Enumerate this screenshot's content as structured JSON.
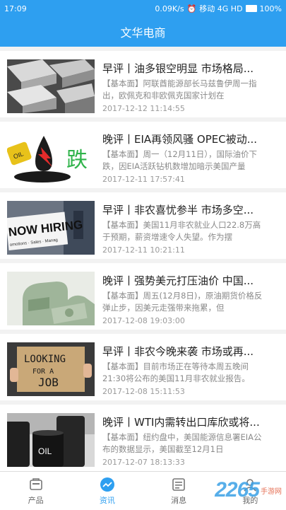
{
  "status_bar": {
    "time": "17:09",
    "network_speed": "0.09K/s",
    "carrier": "移动 4G HD",
    "battery": "100%"
  },
  "header": {
    "title": "文华电商"
  },
  "articles": [
    {
      "title": "早评丨油多银空明显 市场格局...",
      "desc": "【基本面】阿联酋能源部长马兹鲁伊周一指出，欧佩克和非欧佩克国家计划在",
      "time": "2017-12-12 11:14:55"
    },
    {
      "title": "晚评丨EIA再领风骚 OPEC被动...",
      "desc": "【基本面】周一（12月11日），国际油价下跌，因EIA活跃钻机数增加暗示美国产量",
      "time": "2017-12-11 17:57:41"
    },
    {
      "title": "早评丨非农喜忧参半 市场多空...",
      "desc": "【基本面】美国11月非农就业人口22.8万高于预期，薪资增速令人失望。作为摆",
      "time": "2017-12-11 10:21:11"
    },
    {
      "title": "晚评丨强势美元打压油价 中国...",
      "desc": "【基本面】周五(12月8日)，原油期货价格反弹止步，因美元走强带来拖累，但",
      "time": "2017-12-08 19:03:00"
    },
    {
      "title": "早评丨非农今晚来袭 市场或再...",
      "desc": "【基本面】目前市场正在等待本周五晚间21:30将公布的美国11月非农就业报告。",
      "time": "2017-12-08 15:11:53"
    },
    {
      "title": "晚评丨WTI内需转出口库欣或将...",
      "desc": "【基本面】纽约盘中，美国能源信息署EIA公布的数据显示，美国截至12月1日",
      "time": "2017-12-07 18:13:33"
    }
  ],
  "thumbnails": {
    "oil_label": "OIL",
    "die_label": "跌",
    "hiring_label": "NOW HIRING",
    "hiring_sub": "omotions · Sales · Manag",
    "sign_line1": "LOOKING",
    "sign_line2": "FOR A",
    "sign_line3": "JOB",
    "barrel_label": "OIL"
  },
  "tabs": [
    {
      "label": "产品",
      "icon": "product-icon",
      "active": false
    },
    {
      "label": "资讯",
      "icon": "news-trend-icon",
      "active": true
    },
    {
      "label": "消息",
      "icon": "message-icon",
      "active": false
    },
    {
      "label": "我的",
      "icon": "profile-icon",
      "active": false
    }
  ],
  "watermark": {
    "number": "2265",
    "suffix": "手游网"
  },
  "colors": {
    "accent": "#2e9ff0"
  }
}
